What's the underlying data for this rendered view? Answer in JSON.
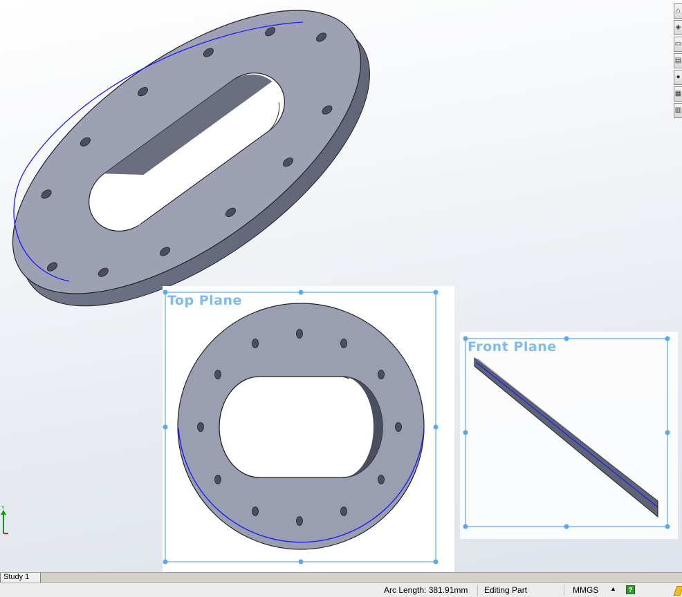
{
  "viewport": {
    "planes": {
      "top": "Top Plane",
      "front": "Front Plane"
    },
    "colors": {
      "part_face": "#999eb0",
      "part_dark": "#6d7185",
      "plane_border": "#5aa9ec",
      "plane_label": "#7fbaf0",
      "edge_highlight": "#1a1aff"
    }
  },
  "taskpane": {
    "icons": [
      "home-icon",
      "resources-icon",
      "folder-icon",
      "file-explorer-icon",
      "appearance-icon",
      "custom-properties-icon",
      "library-icon"
    ]
  },
  "triad": {
    "axis": "Y"
  },
  "tabs": [
    {
      "label": "Study 1"
    }
  ],
  "status": {
    "arc_length": "Arc Length: 381.91mm",
    "mode": "Editing Part",
    "units": "MMGS",
    "caret": "▲",
    "help": "?"
  }
}
